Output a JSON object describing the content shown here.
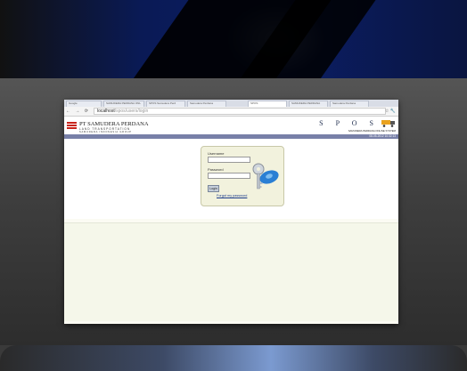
{
  "browser": {
    "tabs": [
      "Google",
      "SAMUDERA PERDANA ONL",
      "SPOS Samudera Perd",
      "Samudera Perdana",
      "SPOS",
      "SAMUDERA PERDANA",
      "Samudera Perdana"
    ],
    "nav_buttons": "← → ⟳",
    "url_host": "localhost",
    "url_path": "/spos/users/login",
    "toolbar_icons": "☆ 🔧"
  },
  "header": {
    "company_name": "PT SAMUDERA PERDANA",
    "company_subtitle": "LAND TRANSPORTATION",
    "company_group": "SAMUDERA INDONESIA GROUP",
    "app_name": "S P O S",
    "app_tagline": "SAMUDERA PERDANA ONLINE SYSTEM",
    "datetime": "08-05-2012 10:32:13"
  },
  "login": {
    "username_label": "Username",
    "password_label": "Password",
    "login_button": "Login",
    "forgot_link": "Forgot my password"
  },
  "colors": {
    "brand_red": "#c8241b",
    "strip_blue": "#7880a8",
    "login_bg": "#f2f2dd"
  }
}
